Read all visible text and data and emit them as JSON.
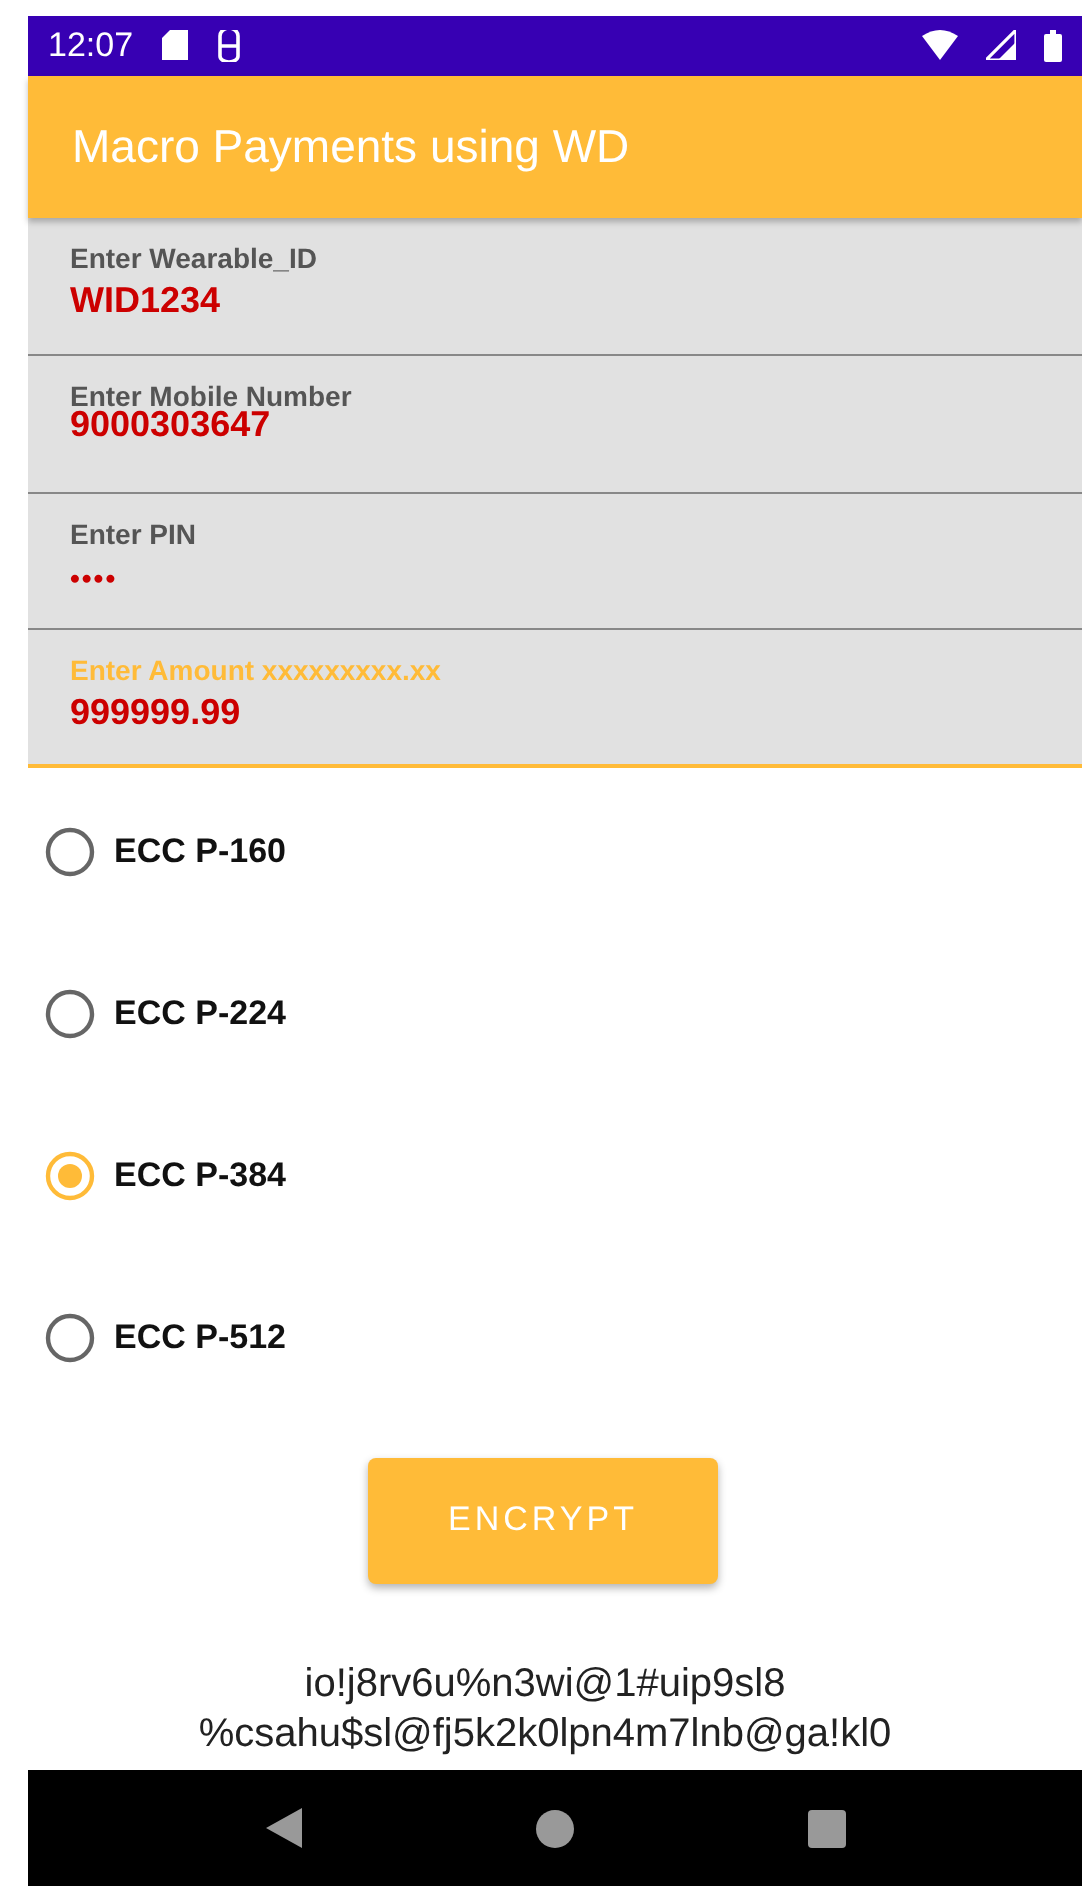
{
  "status_bar": {
    "time": "12:07"
  },
  "app_bar": {
    "title": "Macro Payments using WD"
  },
  "fields": [
    {
      "label": "Enter Wearable_ID",
      "value": "WID1234",
      "focused": false,
      "kind": "text"
    },
    {
      "label": "Enter Mobile Number",
      "value": "9000303647",
      "focused": false,
      "kind": "tight"
    },
    {
      "label": "Enter PIN",
      "value": "••••",
      "focused": false,
      "kind": "password"
    },
    {
      "label": "Enter Amount xxxxxxxxx.xx",
      "value": "999999.99",
      "focused": true,
      "kind": "text"
    }
  ],
  "curves": [
    {
      "label": "ECC P-160",
      "selected": false
    },
    {
      "label": "ECC P-224",
      "selected": false
    },
    {
      "label": "ECC P-384",
      "selected": true
    },
    {
      "label": "ECC P-512",
      "selected": false
    }
  ],
  "encrypt_button": "ENCRYPT",
  "cipher_text": [
    "io!j8rv6u%n3wi@1#uip9sl8",
    "%csahu$sl@fj5k2k0lpn4m7lnb@ga!kl0"
  ]
}
